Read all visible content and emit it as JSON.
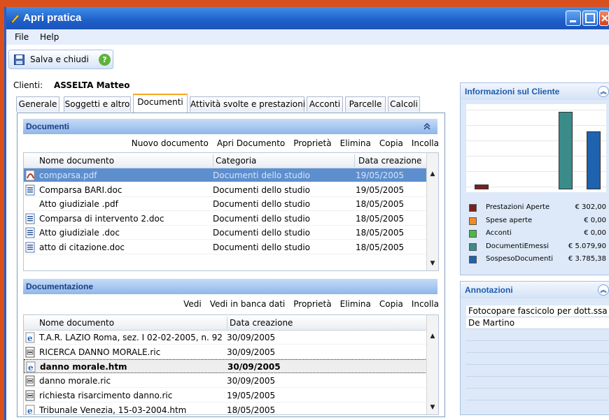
{
  "window": {
    "title": "Apri pratica"
  },
  "menu": [
    "File",
    "Help"
  ],
  "toolbar": {
    "save_label": "Salva e chiudi"
  },
  "client": {
    "label": "Clienti:",
    "name": "ASSELTA Matteo"
  },
  "tabs": [
    "Generale",
    "Soggetti e altro",
    "Documenti",
    "Attività svolte e prestazioni",
    "Acconti",
    "Parcelle",
    "Calcoli"
  ],
  "documenti": {
    "title": "Documenti",
    "actions": [
      "Nuovo documento",
      "Apri Documento",
      "Proprietà",
      "Elimina",
      "Copia",
      "Incolla"
    ],
    "columns": [
      "Nome documento",
      "Categoria",
      "Data creazione"
    ],
    "rows": [
      {
        "icon": "pdf-icon",
        "name": "comparsa.pdf",
        "category": "Documenti dello studio",
        "date": "19/05/2005"
      },
      {
        "icon": "word-doc-icon",
        "name": "Comparsa BARI.doc",
        "category": "Documenti dello studio",
        "date": "19/05/2005"
      },
      {
        "icon": "",
        "name": "Atto giudiziale .pdf",
        "category": "Documenti dello studio",
        "date": "18/05/2005"
      },
      {
        "icon": "word-doc-icon",
        "name": "Comparsa di intervento 2.doc",
        "category": "Documenti dello studio",
        "date": "18/05/2005"
      },
      {
        "icon": "word-doc-icon",
        "name": "Atto giudiziale .doc",
        "category": "Documenti dello studio",
        "date": "18/05/2005"
      },
      {
        "icon": "word-doc-icon",
        "name": "atto di citazione.doc",
        "category": "Documenti dello studio",
        "date": "18/05/2005"
      }
    ]
  },
  "documentazione": {
    "title": "Documentazione",
    "actions": [
      "Vedi",
      "Vedi in banca dati",
      "Proprietà",
      "Elimina",
      "Copia",
      "Incolla"
    ],
    "columns": [
      "Nome documento",
      "Data creazione"
    ],
    "rows": [
      {
        "icon": "ie-icon",
        "name": "T.A.R. LAZIO Roma, sez. I 02-02-2005, n. 92",
        "date": "30/09/2005"
      },
      {
        "icon": "ric-icon",
        "name": "RICERCA DANNO MORALE.ric",
        "date": "30/09/2005"
      },
      {
        "icon": "ie-icon",
        "name": "danno morale.htm",
        "date": "30/09/2005"
      },
      {
        "icon": "ric-icon",
        "name": "danno morale.ric",
        "date": "30/09/2005"
      },
      {
        "icon": "ric-icon",
        "name": "richiesta risarcimento danno.ric",
        "date": "19/05/2005"
      },
      {
        "icon": "ie-icon",
        "name": "Tribunale Venezia, 15-03-2004.htm",
        "date": "18/05/2005"
      }
    ]
  },
  "info_panel": {
    "title": "Informazioni sul Cliente",
    "legend": [
      {
        "name": "Prestazioni Aperte",
        "value": "€ 302,00",
        "color": "#7b2020"
      },
      {
        "name": "Spese aperte",
        "value": "€ 0,00",
        "color": "#f08a2a"
      },
      {
        "name": "Acconti",
        "value": "€ 0,00",
        "color": "#4cb848"
      },
      {
        "name": "DocumentiEmessi",
        "value": "€ 5.079,90",
        "color": "#3a8c8a"
      },
      {
        "name": "SospesoDocumenti",
        "value": "€ 3.785,38",
        "color": "#1f62b0"
      }
    ]
  },
  "chart_data": {
    "type": "bar",
    "categories": [
      "Prestazioni Aperte",
      "Spese aperte",
      "Acconti",
      "DocumentiEmessi",
      "SospesoDocumenti"
    ],
    "values": [
      302.0,
      0.0,
      0.0,
      5079.9,
      3785.38
    ],
    "ylim": [
      0,
      5400
    ],
    "grid": true
  },
  "annotations": {
    "title": "Annotazioni",
    "lines": [
      "Fotocopare fascicolo per dott.ssa",
      "De Martino"
    ]
  }
}
